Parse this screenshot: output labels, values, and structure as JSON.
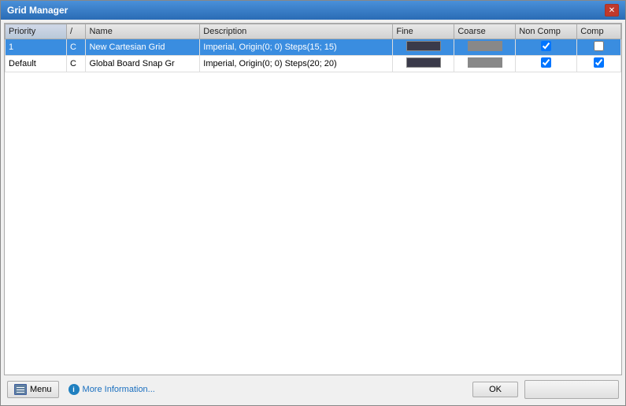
{
  "window": {
    "title": "Grid Manager",
    "close_btn": "✕"
  },
  "table": {
    "columns": [
      {
        "id": "priority",
        "label": "Priority",
        "sorted": true
      },
      {
        "id": "type",
        "label": "/"
      },
      {
        "id": "name",
        "label": "Name"
      },
      {
        "id": "description",
        "label": "Description"
      },
      {
        "id": "fine",
        "label": "Fine"
      },
      {
        "id": "coarse",
        "label": "Coarse"
      },
      {
        "id": "noncomp",
        "label": "Non Comp"
      },
      {
        "id": "comp",
        "label": "Comp"
      }
    ],
    "rows": [
      {
        "priority": "1",
        "type": "C",
        "name": "New Cartesian Grid",
        "description": "Imperial, Origin(0; 0) Steps(15; 15)",
        "fine_color": "#3a3a4a",
        "coarse_color": "#888888",
        "noncomp_checked": true,
        "comp_checked": false,
        "selected": true
      },
      {
        "priority": "Default",
        "type": "C",
        "name": "Global Board Snap Gr",
        "description": "Imperial, Origin(0; 0) Steps(20; 20)",
        "fine_color": "#3a3a4a",
        "coarse_color": "#888888",
        "noncomp_checked": true,
        "comp_checked": true,
        "selected": false
      }
    ]
  },
  "footer": {
    "menu_label": "Menu",
    "info_label": "More Information...",
    "ok_label": "OK"
  }
}
